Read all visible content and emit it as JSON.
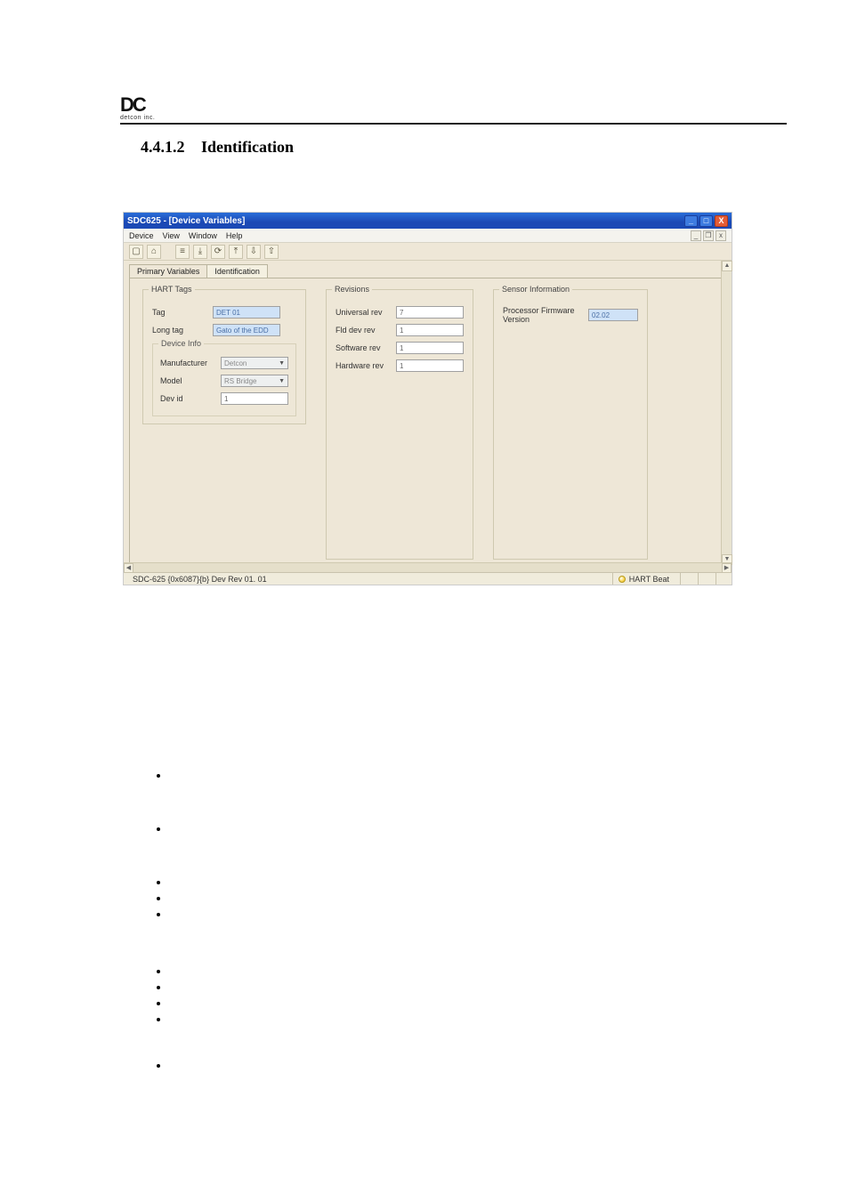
{
  "logo": {
    "glyph": "DC",
    "sub": "detcon inc."
  },
  "section": {
    "number": "4.4.1.2",
    "title": "Identification"
  },
  "window": {
    "title": "SDC625 - [Device Variables]",
    "ctrls": {
      "min": "_",
      "max": "□",
      "close": "X"
    },
    "mdi": {
      "min": "_",
      "restore": "❐",
      "close": "x"
    }
  },
  "menubar": {
    "items": [
      "Device",
      "View",
      "Window",
      "Help"
    ]
  },
  "toolbar": {
    "icons": [
      "▢",
      "⌂",
      "≡",
      "⤓",
      "⟳",
      "⤒",
      "⇩",
      "⇧"
    ]
  },
  "tabs": [
    {
      "label": "Primary Variables",
      "active": false
    },
    {
      "label": "Identification",
      "active": true
    }
  ],
  "groups": {
    "hartTags": {
      "legend": "HART Tags",
      "tag": {
        "label": "Tag",
        "value": "DET 01"
      },
      "longTag": {
        "label": "Long tag",
        "value": "Gato of the EDD"
      }
    },
    "devInfo": {
      "legend": "Device Info",
      "manufacturer": {
        "label": "Manufacturer",
        "value": "Detcon"
      },
      "model": {
        "label": "Model",
        "value": "RS Bridge"
      },
      "devId": {
        "label": "Dev id",
        "value": "1"
      }
    },
    "revisions": {
      "legend": "Revisions",
      "universal": {
        "label": "Universal rev",
        "value": "7"
      },
      "fldDev": {
        "label": "Fld dev rev",
        "value": "1"
      },
      "software": {
        "label": "Software rev",
        "value": "1"
      },
      "hardware": {
        "label": "Hardware rev",
        "value": "1"
      }
    },
    "sensor": {
      "legend": "Sensor Information",
      "procFw": {
        "label": "Processor Firmware Version",
        "value": "02.02"
      }
    }
  },
  "status": {
    "left": "SDC-625   {0x6087}{b} Dev Rev 01. 01",
    "beat": "HART Beat"
  }
}
